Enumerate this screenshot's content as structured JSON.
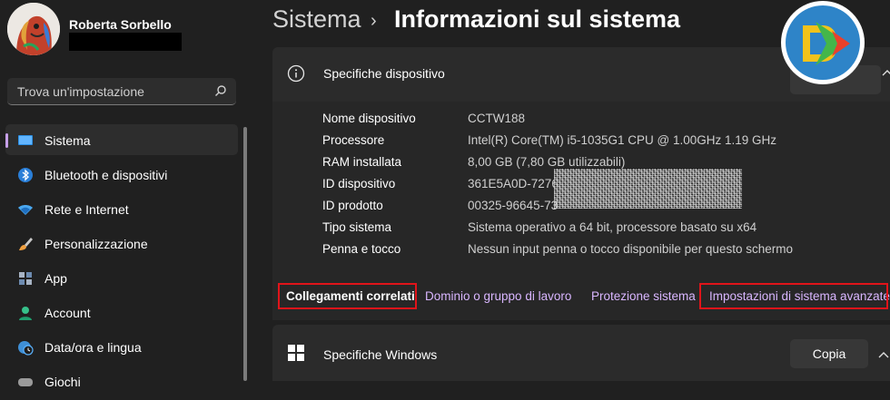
{
  "user": {
    "name": "Roberta Sorbello"
  },
  "search": {
    "placeholder": "Trova un'impostazione"
  },
  "sidebar": {
    "items": [
      {
        "label": "Sistema",
        "icon": "monitor-icon",
        "active": true
      },
      {
        "label": "Bluetooth e dispositivi",
        "icon": "bluetooth-icon"
      },
      {
        "label": "Rete e Internet",
        "icon": "wifi-icon"
      },
      {
        "label": "Personalizzazione",
        "icon": "brush-icon"
      },
      {
        "label": "App",
        "icon": "apps-icon"
      },
      {
        "label": "Account",
        "icon": "account-icon"
      },
      {
        "label": "Data/ora e lingua",
        "icon": "globe-clock-icon"
      },
      {
        "label": "Giochi",
        "icon": "gamepad-icon"
      }
    ]
  },
  "breadcrumb": {
    "parent": "Sistema",
    "separator": "›",
    "current": "Informazioni sul sistema"
  },
  "device_specs": {
    "title": "Specifiche dispositivo",
    "rows": [
      {
        "key": "Nome dispositivo",
        "value": "CCTW188"
      },
      {
        "key": "Processore",
        "value": "Intel(R) Core(TM) i5-1035G1 CPU @ 1.00GHz   1.19 GHz"
      },
      {
        "key": "RAM installata",
        "value": "8,00 GB (7,80 GB utilizzabili)"
      },
      {
        "key": "ID dispositivo",
        "value": "361E5A0D-7276"
      },
      {
        "key": "ID prodotto",
        "value": "00325-96645-73"
      },
      {
        "key": "Tipo sistema",
        "value": "Sistema operativo a 64 bit, processore basato su x64"
      },
      {
        "key": "Penna e tocco",
        "value": "Nessun input penna o tocco disponibile per questo schermo"
      }
    ]
  },
  "related_links": {
    "heading": "Collegamenti correlati",
    "domain": "Dominio o gruppo di lavoro",
    "protection": "Protezione sistema",
    "advanced": "Impostazioni di sistema avanzate"
  },
  "windows_specs": {
    "title": "Specifiche Windows",
    "copy_label": "Copia"
  },
  "colors": {
    "accent": "#c6a0e8",
    "link": "#d9b6ff",
    "highlight": "#e0141a",
    "background": "#202020"
  }
}
